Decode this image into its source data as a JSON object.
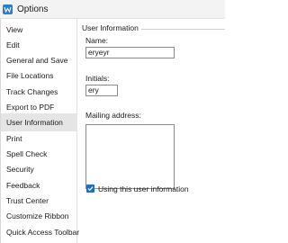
{
  "window": {
    "title": "Options",
    "app_icon": "word-app-icon"
  },
  "sidebar": {
    "items": [
      {
        "label": "View",
        "selected": false
      },
      {
        "label": "Edit",
        "selected": false
      },
      {
        "label": "General and Save",
        "selected": false
      },
      {
        "label": "File Locations",
        "selected": false
      },
      {
        "label": "Track Changes",
        "selected": false
      },
      {
        "label": "Export to PDF",
        "selected": false
      },
      {
        "label": "User Information",
        "selected": true
      },
      {
        "label": "Print",
        "selected": false
      },
      {
        "label": "Spell Check",
        "selected": false
      },
      {
        "label": "Security",
        "selected": false
      },
      {
        "label": "Feedback",
        "selected": false
      },
      {
        "label": "Trust Center",
        "selected": false
      },
      {
        "label": "Customize Ribbon",
        "selected": false
      },
      {
        "label": "Quick Access Toolbar",
        "selected": false
      }
    ]
  },
  "user_info": {
    "group_title": "User Information",
    "name_label": "Name:",
    "name_value": "eryeyr",
    "initials_label": "Initials:",
    "initials_value": "ery",
    "mailing_label": "Mailing address:",
    "mailing_value": "",
    "use_info_label": "Using this user information",
    "use_info_checked": true
  },
  "colors": {
    "accent": "#1f6fc5",
    "selected_bg": "#e5e5e5"
  }
}
